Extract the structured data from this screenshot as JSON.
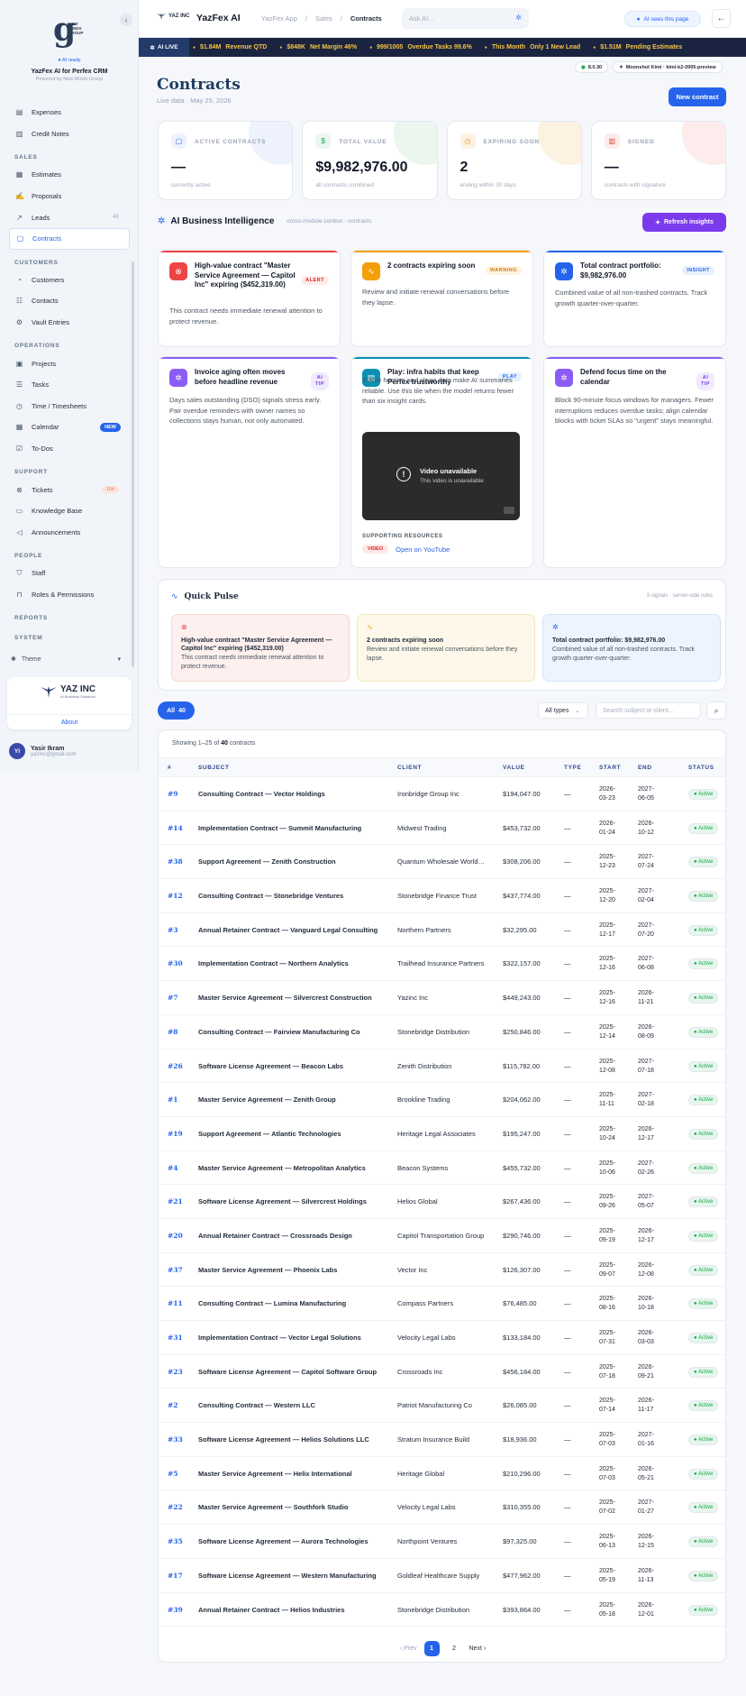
{
  "sidebar": {
    "ai_ready": "AI ready",
    "brand_logo_text": "NEW MINDS GROUP",
    "title": "YazFex AI for Perfex CRM",
    "subtitle": "Powered by New Minds Group",
    "items": [
      {
        "label": "Expenses",
        "icon": "receipt-icon"
      },
      {
        "label": "Credit Notes",
        "icon": "file-icon"
      },
      {
        "section": "SALES"
      },
      {
        "label": "Estimates",
        "icon": "document-icon"
      },
      {
        "label": "Proposals",
        "icon": "thumbs-up-icon"
      },
      {
        "label": "Leads",
        "icon": "trend-icon",
        "count": "40"
      },
      {
        "label": "Contracts",
        "icon": "contract-icon",
        "active": true
      },
      {
        "section": "CUSTOMERS"
      },
      {
        "label": "Customers",
        "icon": "user-icon"
      },
      {
        "label": "Contacts",
        "icon": "contacts-icon"
      },
      {
        "label": "Vault Entries",
        "icon": "vault-icon"
      },
      {
        "section": "OPERATIONS"
      },
      {
        "label": "Projects",
        "icon": "projects-icon"
      },
      {
        "label": "Tasks",
        "icon": "tasks-icon"
      },
      {
        "label": "Time / Timesheets",
        "icon": "clock-icon"
      },
      {
        "label": "Calendar",
        "icon": "calendar-icon",
        "badge": "NEW"
      },
      {
        "label": "To-Dos",
        "icon": "todo-icon"
      },
      {
        "section": "SUPPORT"
      },
      {
        "label": "Tickets",
        "icon": "ticket-icon",
        "tag": "104"
      },
      {
        "label": "Knowledge Base",
        "icon": "book-icon"
      },
      {
        "label": "Announcements",
        "icon": "megaphone-icon"
      },
      {
        "section": "PEOPLE"
      },
      {
        "label": "Staff",
        "icon": "shield-icon"
      },
      {
        "label": "Roles & Permissions",
        "icon": "lock-icon"
      },
      {
        "section": "REPORTS"
      },
      {
        "section": "SYSTEM"
      }
    ],
    "theme_label": "Theme",
    "company": {
      "name": "YAZ INC",
      "tagline": "AI Business Solutions",
      "about": "About"
    },
    "user": {
      "initials": "YI",
      "name": "Yasir Ikram",
      "email": "yazinc@gmail.com"
    }
  },
  "topbar": {
    "logo_text": "YAZ INC",
    "brand": "YazFex AI",
    "breadcrumb": [
      "YazFex App",
      "Sales",
      "Contracts"
    ],
    "search_placeholder": "Ask AI...",
    "ai_sees": "AI sees this page",
    "back": "←"
  },
  "ticker": {
    "live_label": "AI LIVE",
    "items": [
      {
        "value": "$1.84M",
        "label": "Revenue QTD"
      },
      {
        "value": "$848K",
        "label": "Net Margin 46%"
      },
      {
        "value": "999/1005",
        "label": "Overdue Tasks 99.6%"
      },
      {
        "value": "This Month",
        "label": "Only 1 New Lead"
      },
      {
        "value": "$1.51M",
        "label": "Pending Estimates"
      }
    ]
  },
  "version_pills": {
    "version": "8.0.30",
    "model": "Moonshot Kimi · kimi-k2-0905-preview"
  },
  "page": {
    "title": "Contracts",
    "subtitle": "Live data · May 25, 2026",
    "new_button": "New contract"
  },
  "stats": [
    {
      "label": "ACTIVE CONTRACTS",
      "value": "—",
      "caption": "currently active",
      "color": "#2563eb",
      "tint": "#eef2fd"
    },
    {
      "label": "TOTAL VALUE",
      "value": "$9,982,976.00",
      "caption": "all contracts combined",
      "color": "#16a34a",
      "tint": "#eaf6ee"
    },
    {
      "label": "EXPIRING SOON",
      "value": "2",
      "caption": "ending within 30 days",
      "color": "#f59e0b",
      "tint": "#fdf1e2"
    },
    {
      "label": "SIGNED",
      "value": "—",
      "caption": "contracts with signature",
      "color": "#ef4444",
      "tint": "#fdeceb"
    }
  ],
  "ai": {
    "title": "AI Business Intelligence",
    "subtitle": "cross-module context · contracts",
    "refresh": "Refresh insights",
    "cards": [
      {
        "title": "High-value contract \"Master Service Agreement — Capitol Inc\" expiring ($452,319.00)",
        "tag": "ALERT",
        "body": "This contract needs immediate renewal attention to protect revenue.",
        "color": "#ef4444",
        "icon": "alert-icon"
      },
      {
        "title": "2 contracts expiring soon",
        "tag": "WARNING",
        "body": "Review and initiate renewal conversations before they lapse.",
        "color": "#f59e0b",
        "icon": "pulse-icon"
      },
      {
        "title": "Total contract portfolio: $9,982,976.00",
        "tag": "INSIGHT",
        "body": "Combined value of all non-trashed contracts. Track growth quarter-over-quarter.",
        "color": "#2563eb",
        "icon": "sparkle-icon"
      },
      {
        "title": "Invoice aging often moves before headline revenue",
        "tag": "AI TIP",
        "body": "Days sales outstanding (DSO) signals stress early. Pair overdue reminders with owner names so collections stays human, not only automated.",
        "color": "#8b5cf6",
        "icon": "sparkle-icon"
      },
      {
        "title": "Play: infra habits that keep Perfex trustworthy",
        "tag": "PLAY",
        "body": "Stable hosting and clean data make AI summaries reliable. Use this tile when the model returns fewer than six insight cards.",
        "color": "#0891b2",
        "icon": "db-icon",
        "video": {
          "title": "Video unavailable",
          "sub": "This video is unavailable"
        },
        "resources_label": "SUPPORTING RESOURCES",
        "resource_tag": "VIDEO",
        "resource_link": "Open on YouTube"
      },
      {
        "title": "Defend focus time on the calendar",
        "tag": "AI TIP",
        "body": "Block 90-minute focus windows for managers. Fewer interruptions reduces overdue tasks; align calendar blocks with ticket SLAs so \"urgent\" stays meaningful.",
        "color": "#8b5cf6",
        "icon": "sparkle-icon"
      }
    ]
  },
  "pulse": {
    "title": "Quick Pulse",
    "meta": "3 signals · server-side rules",
    "cards": [
      {
        "title": "High-value contract \"Master Service Agreement — Capitol Inc\" expiring ($452,319.00)",
        "body": "This contract needs immediate renewal attention to protect revenue.",
        "bg": "#fdf0ee",
        "border": "#f6d7d2",
        "iconcolor": "#ef4444",
        "icon": "alert-icon"
      },
      {
        "title": "2 contracts expiring soon",
        "body": "Review and initiate renewal conversations before they lapse.",
        "bg": "#fdf8ea",
        "border": "#f3e5bd",
        "iconcolor": "#f59e0b",
        "icon": "pulse-icon"
      },
      {
        "title": "Total contract portfolio: $9,982,976.00",
        "body": "Combined value of all non-trashed contracts. Track growth quarter-over-quarter.",
        "bg": "#eef4fd",
        "border": "#d5e3f8",
        "iconcolor": "#2563eb",
        "icon": "sparkle-icon"
      }
    ]
  },
  "filters": {
    "all_label": "All",
    "all_count": "40",
    "types": "All types",
    "search_placeholder": "Search subject or client..."
  },
  "table": {
    "showing_prefix": "Showing 1–25 of",
    "showing_total": "40",
    "showing_suffix": "contracts",
    "headers": [
      "#",
      "SUBJECT",
      "CLIENT",
      "VALUE",
      "TYPE",
      "START",
      "END",
      "STATUS"
    ],
    "rows": [
      [
        "#9",
        "Consulting Contract — Vector Holdings",
        "Ironbridge Group Inc",
        "$194,047.00",
        "—",
        "2026-03-23",
        "2027-06-05",
        "Active"
      ],
      [
        "#14",
        "Implementation Contract — Summit Manufacturing",
        "Midwest Trading",
        "$453,732.00",
        "—",
        "2026-01-24",
        "2026-10-12",
        "Active"
      ],
      [
        "#38",
        "Support Agreement — Zenith Construction",
        "Quantum Wholesale Worldwide",
        "$308,206.00",
        "—",
        "2025-12-23",
        "2027-07-24",
        "Active"
      ],
      [
        "#12",
        "Consulting Contract — Stonebridge Ventures",
        "Stonebridge Finance Trust",
        "$437,774.00",
        "—",
        "2025-12-20",
        "2027-02-04",
        "Active"
      ],
      [
        "#3",
        "Annual Retainer Contract — Vanguard Legal Consulting",
        "Northern Partners",
        "$32,295.00",
        "—",
        "2025-12-17",
        "2027-07-20",
        "Active"
      ],
      [
        "#30",
        "Implementation Contract — Northern Analytics",
        "Trailhead Insurance Partners",
        "$322,157.00",
        "—",
        "2025-12-16",
        "2027-06-08",
        "Active"
      ],
      [
        "#7",
        "Master Service Agreement — Silvercrest Construction",
        "Yazinc Inc",
        "$449,243.00",
        "—",
        "2025-12-16",
        "2026-11-21",
        "Active"
      ],
      [
        "#8",
        "Consulting Contract — Fairview Manufacturing Co",
        "Stonebridge Distribution",
        "$250,846.00",
        "—",
        "2025-12-14",
        "2026-08-09",
        "Active"
      ],
      [
        "#26",
        "Software License Agreement — Beacon Labs",
        "Zenith Distribution",
        "$115,782.00",
        "—",
        "2025-12-08",
        "2027-07-18",
        "Active"
      ],
      [
        "#1",
        "Master Service Agreement — Zenith Group",
        "Brookline Trading",
        "$204,062.00",
        "—",
        "2025-11-11",
        "2027-02-18",
        "Active"
      ],
      [
        "#19",
        "Support Agreement — Atlantic Technologies",
        "Heritage Legal Associates",
        "$195,247.00",
        "—",
        "2025-10-24",
        "2026-12-17",
        "Active"
      ],
      [
        "#4",
        "Master Service Agreement — Metropolitan Analytics",
        "Beacon Systems",
        "$455,732.00",
        "—",
        "2025-10-06",
        "2027-02-26",
        "Active"
      ],
      [
        "#21",
        "Software License Agreement — Silvercrest Holdings",
        "Helios Global",
        "$267,436.00",
        "—",
        "2025-09-26",
        "2027-05-07",
        "Active"
      ],
      [
        "#20",
        "Annual Retainer Contract — Crossroads Design",
        "Capitol Transportation Group",
        "$290,746.00",
        "—",
        "2025-09-19",
        "2026-12-17",
        "Active"
      ],
      [
        "#37",
        "Master Service Agreement — Phoenix Labs",
        "Vector Inc",
        "$126,307.00",
        "—",
        "2025-09-07",
        "2026-12-08",
        "Active"
      ],
      [
        "#11",
        "Consulting Contract — Lumina Manufacturing",
        "Compass Partners",
        "$76,485.00",
        "—",
        "2025-08-16",
        "2026-10-18",
        "Active"
      ],
      [
        "#31",
        "Implementation Contract — Vector Legal Solutions",
        "Velocity Legal Labs",
        "$133,184.00",
        "—",
        "2025-07-31",
        "2026-03-03",
        "Active"
      ],
      [
        "#23",
        "Software License Agreement — Capitol Software Group",
        "Crossroads Inc",
        "$456,184.00",
        "—",
        "2025-07-18",
        "2026-09-21",
        "Active"
      ],
      [
        "#2",
        "Consulting Contract — Western LLC",
        "Patriot Manufacturing Co",
        "$26,085.00",
        "—",
        "2025-07-14",
        "2026-11-17",
        "Active"
      ],
      [
        "#33",
        "Software License Agreement — Helios Solutions LLC",
        "Stratum Insurance Build",
        "$18,936.00",
        "—",
        "2025-07-03",
        "2027-01-16",
        "Active"
      ],
      [
        "#5",
        "Master Service Agreement — Helix International",
        "Heritage Global",
        "$210,296.00",
        "—",
        "2025-07-03",
        "2026-05-21",
        "Active"
      ],
      [
        "#22",
        "Master Service Agreement — Southfork Studio",
        "Velocity Legal Labs",
        "$310,355.00",
        "—",
        "2025-07-02",
        "2027-01-27",
        "Active"
      ],
      [
        "#35",
        "Software License Agreement — Aurora Technologies",
        "Northpoint Ventures",
        "$97,325.00",
        "—",
        "2025-06-13",
        "2026-12-15",
        "Active"
      ],
      [
        "#17",
        "Software License Agreement — Western Manufacturing",
        "Goldleaf Healthcare Supply",
        "$477,962.00",
        "—",
        "2025-05-19",
        "2026-11-13",
        "Active"
      ],
      [
        "#39",
        "Annual Retainer Contract — Helios Industries",
        "Stonebridge Distribution",
        "$393,864.00",
        "—",
        "2025-05-18",
        "2026-12-01",
        "Active"
      ]
    ]
  },
  "pager": {
    "prev": "‹ Prev",
    "pages": [
      "1",
      "2"
    ],
    "next": "Next ›"
  }
}
